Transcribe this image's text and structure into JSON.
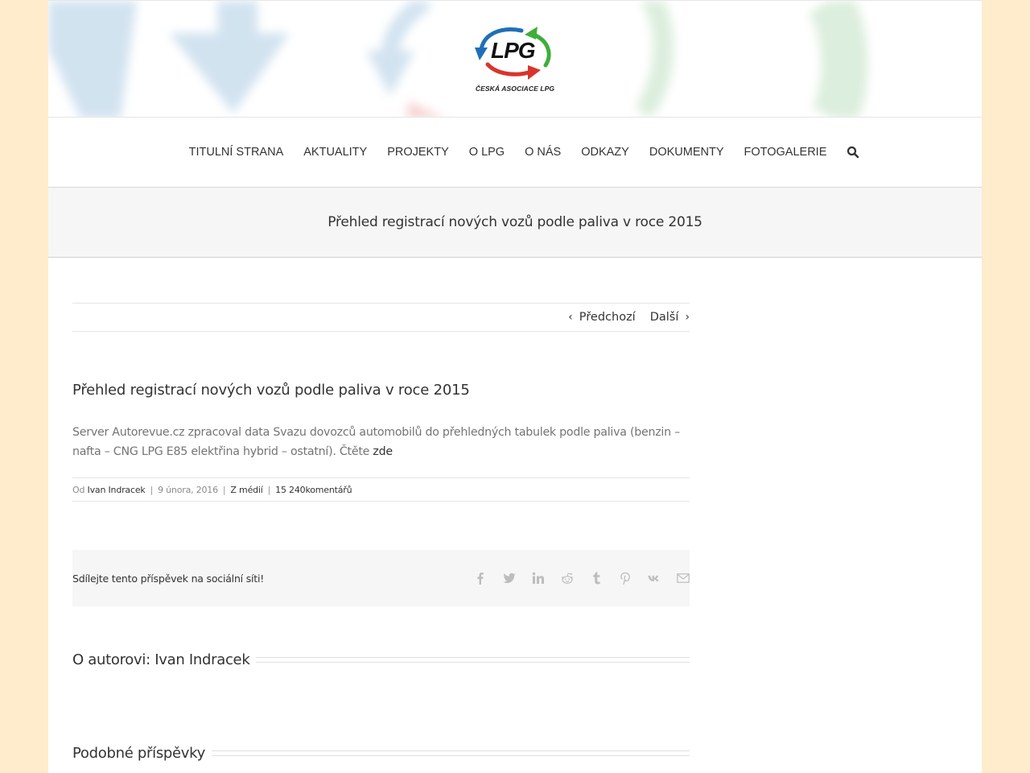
{
  "brand": {
    "logo_text": "LPG",
    "logo_subtitle": "ČESKÁ ASOCIACE LPG",
    "colors": {
      "blue": "#1f6fb8",
      "green": "#3fae3a",
      "red": "#d9342b",
      "page_bg": "#feeccd"
    }
  },
  "nav": {
    "items": [
      {
        "label": "TITULNÍ STRANA"
      },
      {
        "label": "AKTUALITY"
      },
      {
        "label": "PROJEKTY"
      },
      {
        "label": "O LPG"
      },
      {
        "label": "O NÁS"
      },
      {
        "label": "ODKAZY"
      },
      {
        "label": "DOKUMENTY"
      },
      {
        "label": "FOTOGALERIE"
      }
    ],
    "search_icon": "search-icon"
  },
  "page_title": "Přehled registrací nových vozů podle paliva v roce 2015",
  "post_nav": {
    "prev_label": "Předchozí",
    "next_label": "Další"
  },
  "post": {
    "title": "Přehled registrací nových vozů podle paliva v roce 2015",
    "body": "Server Autorevue.cz zpracoval data Svazu dovozců automobilů do přehledných tabulek podle paliva (benzin – nafta – CNG  LPG  E85  elektřina  hybrid – ostatní). Čtěte ",
    "link_label": "zde",
    "meta": {
      "by_prefix": "Od",
      "author": "Ivan Indracek",
      "date": "9 února, 2016",
      "category": "Z médií",
      "comments": "15 240komentářů"
    }
  },
  "share": {
    "text": "Sdílejte tento příspěvek na sociální síti!",
    "icons": [
      "facebook-icon",
      "twitter-icon",
      "linkedin-icon",
      "reddit-icon",
      "tumblr-icon",
      "pinterest-icon",
      "vk-icon",
      "email-icon"
    ]
  },
  "author_section": {
    "title": "O autorovi: Ivan Indracek"
  },
  "related_section": {
    "title": "Podobné příspěvky"
  }
}
